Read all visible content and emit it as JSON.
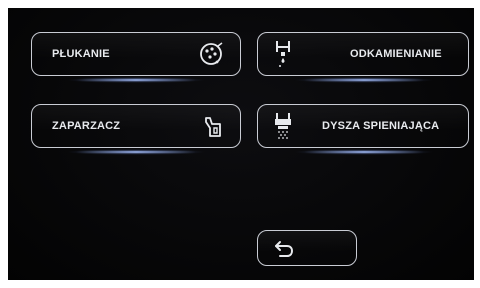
{
  "menu": {
    "items": [
      {
        "label": "PŁUKANIE",
        "icon": "rinse-icon"
      },
      {
        "label": "ODKAMIENIANIE",
        "icon": "descale-icon"
      },
      {
        "label": "ZAPARZACZ",
        "icon": "brew-unit-icon"
      },
      {
        "label": "DYSZA SPIENIAJĄCA",
        "icon": "frother-nozzle-icon"
      }
    ]
  },
  "back_button": {
    "icon": "back-arrow-icon"
  },
  "colors": {
    "screen_background": "#060607",
    "outline": "#c9ccd4",
    "text": "#e8eaee",
    "glow": "#aac3ff"
  }
}
